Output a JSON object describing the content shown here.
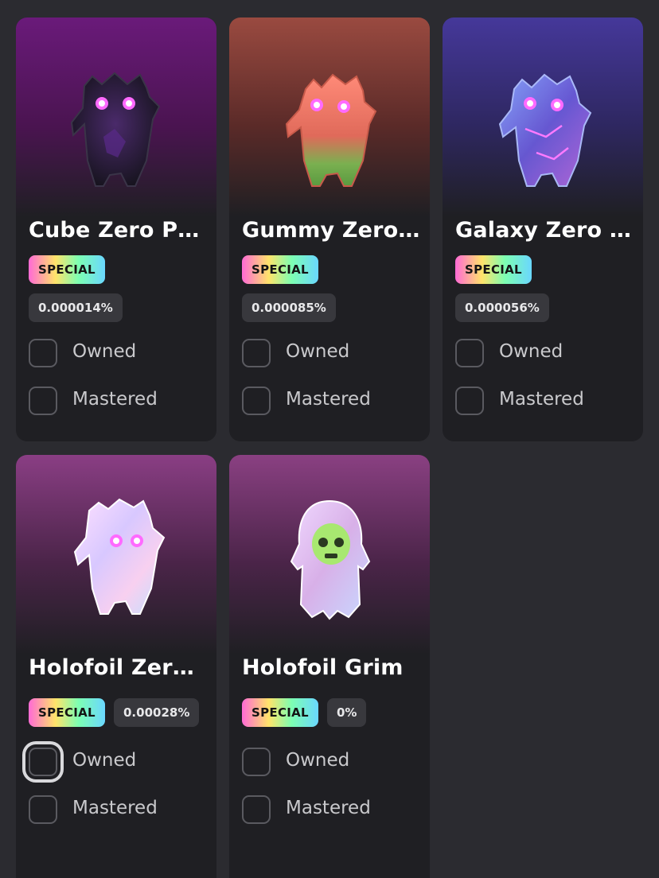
{
  "cards": [
    {
      "title": "Cube Zero Poi...",
      "badge": "SPECIAL",
      "percent": "0.000014%",
      "owned_label": "Owned",
      "mastered_label": "Mastered",
      "theme": {
        "top": "#6a1a7a",
        "mid": "#4a1450"
      },
      "figure": "cube-zero-point-figure"
    },
    {
      "title": "Gummy Zero ...",
      "badge": "SPECIAL",
      "percent": "0.000085%",
      "owned_label": "Owned",
      "mastered_label": "Mastered",
      "theme": {
        "top": "#9a4a40",
        "mid": "#5a2a28"
      },
      "figure": "gummy-zero-figure"
    },
    {
      "title": "Galaxy Zero P...",
      "badge": "SPECIAL",
      "percent": "0.000056%",
      "owned_label": "Owned",
      "mastered_label": "Mastered",
      "theme": {
        "top": "#45389a",
        "mid": "#2e2760"
      },
      "figure": "galaxy-zero-figure"
    },
    {
      "title": "Holofoil Zero ...",
      "badge": "SPECIAL",
      "percent": "0.00028%",
      "owned_label": "Owned",
      "mastered_label": "Mastered",
      "theme": {
        "top": "#8a3e84",
        "mid": "#4a2448"
      },
      "figure": "holofoil-zero-figure"
    },
    {
      "title": "Holofoil Grim",
      "badge": "SPECIAL",
      "percent": "0%",
      "owned_label": "Owned",
      "mastered_label": "Mastered",
      "theme": {
        "top": "#8a4082",
        "mid": "#4a2448"
      },
      "figure": "holofoil-grim-figure"
    }
  ]
}
